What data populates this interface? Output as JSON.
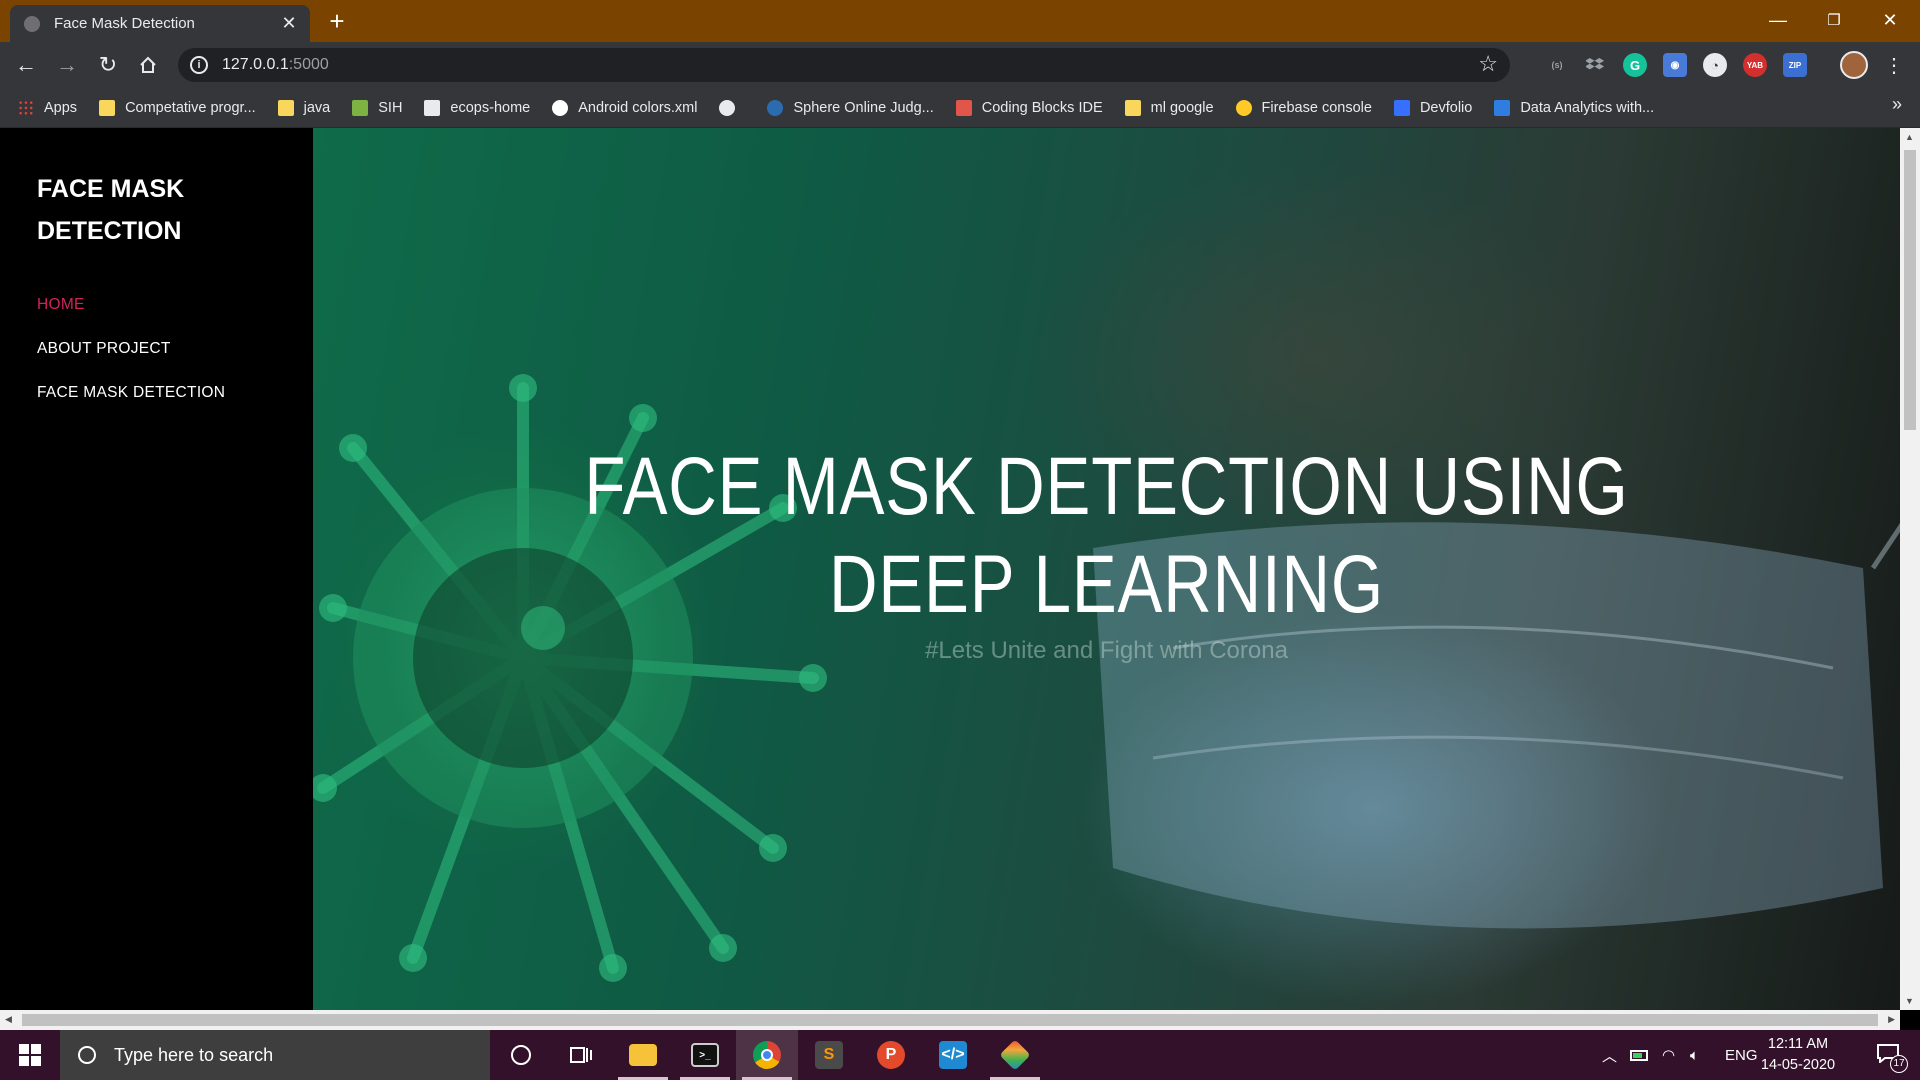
{
  "browser": {
    "tab_title": "Face Mask Detection",
    "tab_close": "✕",
    "new_tab": "+",
    "url_host": "127.0.0.1",
    "url_port": ":5000",
    "window_controls": {
      "minimize": "—",
      "maximize": "❐",
      "close": "✕"
    },
    "extensions": [
      "(s)",
      "dropbox",
      "G",
      "camera",
      "speed",
      "YAB",
      "ZIP"
    ],
    "bookmarks": [
      {
        "label": "Apps",
        "icon": "apps-grid-icon",
        "color": "#e94235"
      },
      {
        "label": "Competative progr...",
        "icon": "folder-icon",
        "color": "#f9d65c"
      },
      {
        "label": "java",
        "icon": "folder-icon",
        "color": "#f9d65c"
      },
      {
        "label": "SIH",
        "icon": "leaf-icon",
        "color": "#7cb342"
      },
      {
        "label": "ecops-home",
        "icon": "site-icon",
        "color": "#e8eaed"
      },
      {
        "label": "Android colors.xml",
        "icon": "github-icon",
        "color": "#ffffff"
      },
      {
        "label": "",
        "icon": "globe-icon",
        "color": "#e8eaed"
      },
      {
        "label": "Sphere Online Judg...",
        "icon": "spoj-icon",
        "color": "#2b6cb0"
      },
      {
        "label": "Coding Blocks IDE",
        "icon": "cube-icon",
        "color": "#e0564a"
      },
      {
        "label": "ml google",
        "icon": "folder-icon",
        "color": "#f9d65c"
      },
      {
        "label": "Firebase console",
        "icon": "firebase-icon",
        "color": "#ffca28"
      },
      {
        "label": "Devfolio",
        "icon": "devfolio-icon",
        "color": "#3770ff"
      },
      {
        "label": "Data Analytics with...",
        "icon": "s-icon",
        "color": "#2f7de1"
      }
    ],
    "bookmarks_more": "»"
  },
  "sidebar": {
    "brand_line1": "FACE MASK",
    "brand_line2": "DETECTION",
    "nav": [
      {
        "label": "HOME",
        "active": true
      },
      {
        "label": "ABOUT PROJECT",
        "active": false
      },
      {
        "label": "FACE MASK DETECTION",
        "active": false
      }
    ]
  },
  "hero": {
    "title_line1": "FACE MASK DETECTION USING",
    "title_line2": "DEEP LEARNING",
    "subtitle": "#Lets Unite and Fight with Corona"
  },
  "taskbar": {
    "search_placeholder": "Type here to search",
    "apps": [
      "cortana",
      "task-view",
      "file-explorer",
      "terminal",
      "chrome",
      "sublime-text",
      "postman",
      "vscode",
      "git"
    ],
    "language": "ENG",
    "time": "12:11 AM",
    "date": "14-05-2020",
    "notification_count": "17"
  },
  "colors": {
    "titlebar": "#7a4300",
    "active_nav": "#d3245a",
    "taskbar": "#33112a"
  }
}
